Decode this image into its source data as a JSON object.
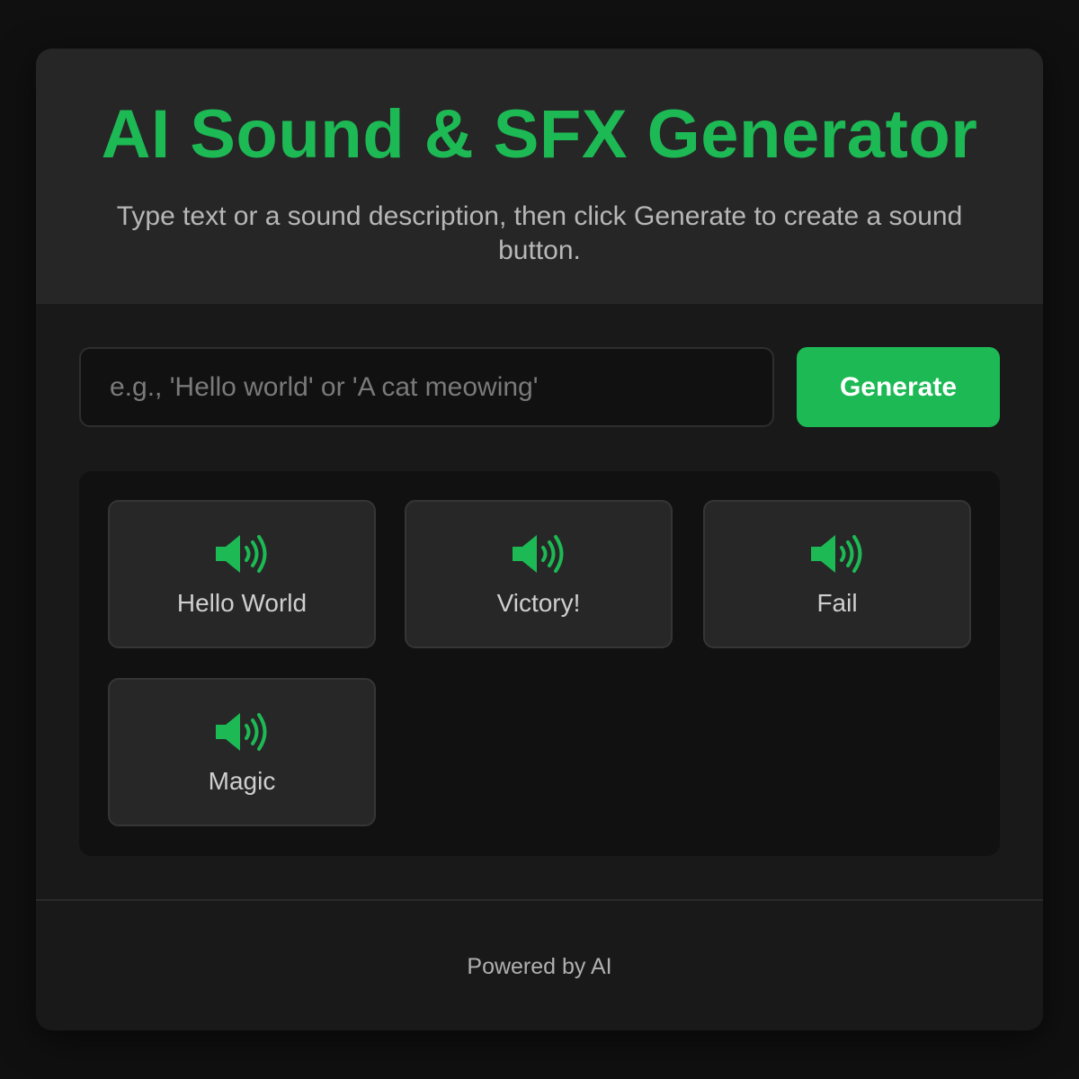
{
  "header": {
    "title": "AI Sound & SFX Generator",
    "subtitle": "Type text or a sound description, then click Generate to create a sound button."
  },
  "prompt": {
    "value": "",
    "placeholder": "e.g., 'Hello world' or 'A cat meowing'"
  },
  "generate_button": {
    "label": "Generate"
  },
  "sounds": [
    {
      "label": "Hello World",
      "icon": "speaker-icon"
    },
    {
      "label": "Victory!",
      "icon": "speaker-icon"
    },
    {
      "label": "Fail",
      "icon": "speaker-icon"
    },
    {
      "label": "Magic",
      "icon": "speaker-icon"
    }
  ],
  "footer": {
    "text": "Powered by AI"
  },
  "colors": {
    "accent": "#1db954",
    "background": "#101010",
    "card": "#191919",
    "header": "#262626",
    "sound_button": "#272727"
  }
}
